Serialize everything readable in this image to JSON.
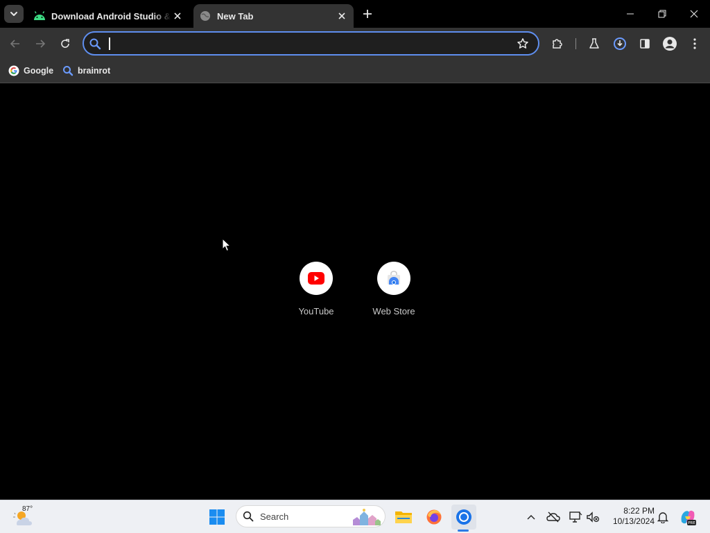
{
  "browser": {
    "tabs": [
      {
        "title": "Download Android Studio & App Tools - Android Developers",
        "active": false,
        "favicon": "android-icon"
      },
      {
        "title": "New Tab",
        "active": true,
        "favicon": "globe-icon"
      }
    ],
    "omnibox": {
      "value": "",
      "placeholder": ""
    },
    "bookmarks": [
      {
        "label": "Google",
        "icon": "google-g-icon"
      },
      {
        "label": "brainrot",
        "icon": "search-icon"
      }
    ],
    "accent_color": "#5f8ff0"
  },
  "new_tab": {
    "shortcuts": [
      {
        "label": "YouTube",
        "icon": "youtube-icon"
      },
      {
        "label": "Web Store",
        "icon": "web-store-icon"
      }
    ]
  },
  "taskbar": {
    "weather": {
      "temp": "87°",
      "icon": "weather-icon"
    },
    "search_placeholder": "Search",
    "pinned": [
      "windows-start-icon",
      "file-explorer-icon",
      "firefox-icon",
      "chrome-icon"
    ],
    "clock": {
      "time": "8:22 PM",
      "date": "10/13/2024"
    }
  }
}
